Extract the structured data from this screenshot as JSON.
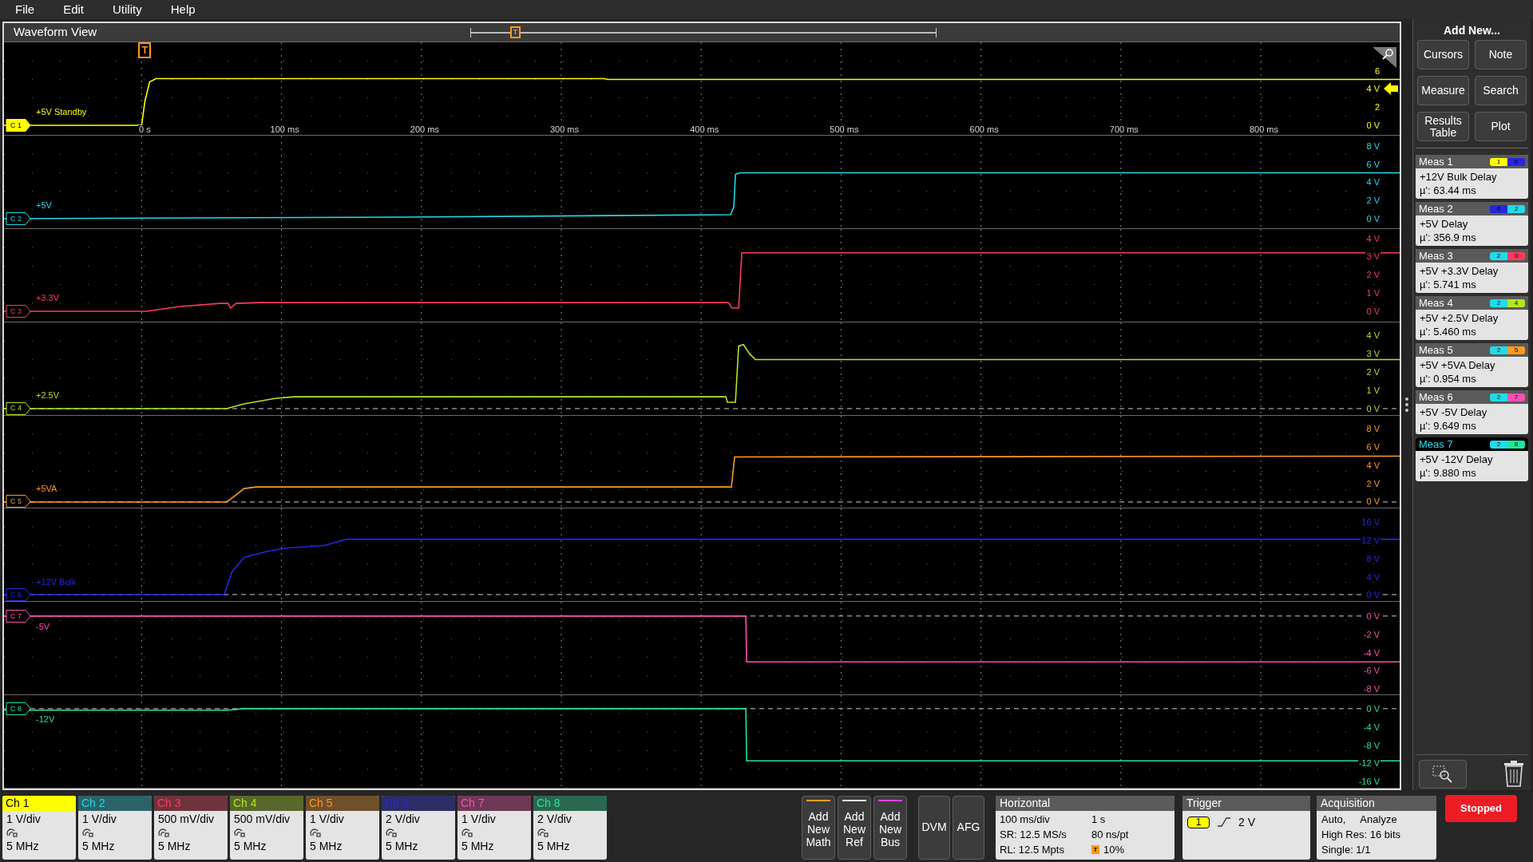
{
  "menu": [
    "File",
    "Edit",
    "Utility",
    "Help"
  ],
  "waveform_view": {
    "title": "Waveform View",
    "overview_mark": "T",
    "trigger_mark": "T",
    "time_labels": [
      "0 s",
      "100 ms",
      "200 ms",
      "300 ms",
      "400 ms",
      "500 ms",
      "600 ms",
      "700 ms",
      "800 ms"
    ],
    "channels": [
      {
        "tag": "C 1",
        "name": "+5V Standby",
        "color": "#ffff00",
        "selected": true,
        "axis_labels": [
          "6",
          "4 V",
          "2",
          "0 V"
        ]
      },
      {
        "tag": "C 2",
        "name": "+5V",
        "color": "#22dbea",
        "selected": false,
        "axis_labels": [
          "8 V",
          "6 V",
          "4 V",
          "2 V",
          "0 V"
        ]
      },
      {
        "tag": "C 3",
        "name": "+3.3V",
        "color": "#ff3b5c",
        "selected": false,
        "axis_labels": [
          "4 V",
          "3 V",
          "2 V",
          "1 V",
          "0 V"
        ]
      },
      {
        "tag": "C 4",
        "name": "+2.5V",
        "color": "#b4e61e",
        "selected": false,
        "axis_labels": [
          "4 V",
          "3 V",
          "2 V",
          "1 V",
          "0 V"
        ]
      },
      {
        "tag": "C 5",
        "name": "+5VA",
        "color": "#ff9a1f",
        "selected": false,
        "axis_labels": [
          "8 V",
          "6 V",
          "4 V",
          "2 V",
          "0 V"
        ]
      },
      {
        "tag": "C 6",
        "name": "+12V Bulk",
        "color": "#2626e0",
        "selected": false,
        "axis_labels": [
          "16 V",
          "12 V",
          "8 V",
          "4 V",
          "0 V"
        ]
      },
      {
        "tag": "C 7",
        "name": "-5V",
        "color": "#ff4fb0",
        "selected": false,
        "axis_labels": [
          "0 V",
          "-2 V",
          "-4 V",
          "-6 V",
          "-8 V"
        ]
      },
      {
        "tag": "C 8",
        "name": "-12V",
        "color": "#1ee89a",
        "selected": false,
        "axis_labels": [
          "0 V",
          "-4 V",
          "-8 V",
          "-12 V",
          "-16 V"
        ]
      }
    ]
  },
  "side_panel": {
    "title": "Add New...",
    "buttons": [
      "Cursors",
      "Note",
      "Measure",
      "Search",
      "Results Table",
      "Plot"
    ],
    "measurements": [
      {
        "title": "Meas 1",
        "source": {
          "label": "1",
          "color": "#ffff00"
        },
        "target": {
          "label": "6",
          "color": "#2626e0"
        },
        "label": "+12V Bulk Delay",
        "value": "µ': 63.44 ms",
        "selected": false
      },
      {
        "title": "Meas 2",
        "source": {
          "label": "6",
          "color": "#2626e0"
        },
        "target": {
          "label": "2",
          "color": "#22dbea"
        },
        "label": "+5V Delay",
        "value": "µ': 356.9 ms",
        "selected": false
      },
      {
        "title": "Meas 3",
        "source": {
          "label": "2",
          "color": "#22dbea"
        },
        "target": {
          "label": "3",
          "color": "#ff3b5c"
        },
        "label": "+5V +3.3V Delay",
        "value": "µ': 5.741 ms",
        "selected": false
      },
      {
        "title": "Meas 4",
        "source": {
          "label": "2",
          "color": "#22dbea"
        },
        "target": {
          "label": "4",
          "color": "#b4e61e"
        },
        "label": "+5V +2.5V Delay",
        "value": "µ': 5.460 ms",
        "selected": false
      },
      {
        "title": "Meas 5",
        "source": {
          "label": "2",
          "color": "#22dbea"
        },
        "target": {
          "label": "5",
          "color": "#ff9a1f"
        },
        "label": "+5V +5VA Delay",
        "value": "µ': 0.954 ms",
        "selected": false
      },
      {
        "title": "Meas 6",
        "source": {
          "label": "2",
          "color": "#22dbea"
        },
        "target": {
          "label": "7",
          "color": "#ff4fb0"
        },
        "label": "+5V -5V Delay",
        "value": "µ': 9.649 ms",
        "selected": false
      },
      {
        "title": "Meas 7",
        "source": {
          "label": "2",
          "color": "#22dbea"
        },
        "target": {
          "label": "8",
          "color": "#1ee89a"
        },
        "label": "+5V -12V Delay",
        "value": "µ': 9.880 ms",
        "selected": true
      }
    ]
  },
  "channel_badges": [
    {
      "label": "Ch 1",
      "scale": "1 V/div",
      "bandwidth": "5 MHz",
      "color": "#ffff00",
      "selected": true
    },
    {
      "label": "Ch 2",
      "scale": "1 V/div",
      "bandwidth": "5 MHz",
      "color": "#22dbea",
      "selected": false
    },
    {
      "label": "Ch 3",
      "scale": "500 mV/div",
      "bandwidth": "5 MHz",
      "color": "#ff3b5c",
      "selected": false
    },
    {
      "label": "Ch 4",
      "scale": "500 mV/div",
      "bandwidth": "5 MHz",
      "color": "#b4e61e",
      "selected": false
    },
    {
      "label": "Ch 5",
      "scale": "1 V/div",
      "bandwidth": "5 MHz",
      "color": "#ff9a1f",
      "selected": false
    },
    {
      "label": "Ch 6",
      "scale": "2 V/div",
      "bandwidth": "5 MHz",
      "color": "#2626e0",
      "selected": false
    },
    {
      "label": "Ch 7",
      "scale": "1 V/div",
      "bandwidth": "5 MHz",
      "color": "#ff4fb0",
      "selected": false
    },
    {
      "label": "Ch 8",
      "scale": "2 V/div",
      "bandwidth": "5 MHz",
      "color": "#1ee89a",
      "selected": false
    }
  ],
  "add_buttons": [
    {
      "label": "Add New Math",
      "color": "#ff9a1f"
    },
    {
      "label": "Add New Ref",
      "color": "#e8e8e8"
    },
    {
      "label": "Add New Bus",
      "color": "#e040e0"
    }
  ],
  "tool_buttons": [
    "DVM",
    "AFG"
  ],
  "horizontal": {
    "title": "Horizontal",
    "position_mark": "T",
    "rows": [
      [
        "100 ms/div",
        "1 s"
      ],
      [
        "SR: 12.5 MS/s",
        "80 ns/pt"
      ],
      [
        "RL: 12.5 Mpts",
        "10%"
      ]
    ]
  },
  "trigger": {
    "title": "Trigger",
    "source": "1",
    "threshold": "2 V"
  },
  "acquisition": {
    "title": "Acquisition",
    "lines": [
      [
        "Auto,",
        "Analyze"
      ],
      [
        "High Res: 16 bits"
      ],
      [
        "Single: 1/1"
      ]
    ]
  },
  "status": "Stopped"
}
